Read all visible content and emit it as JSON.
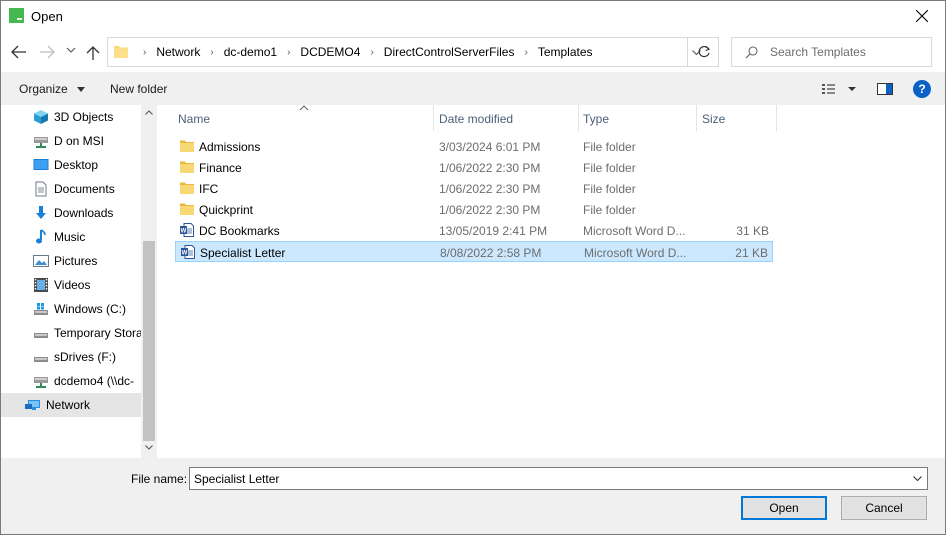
{
  "window": {
    "title": "Open"
  },
  "address": {
    "breadcrumbs": [
      "Network",
      "dc-demo1",
      "DCDEMO4",
      "DirectControlServerFiles",
      "Templates"
    ]
  },
  "search": {
    "placeholder": "Search Templates"
  },
  "toolbar": {
    "organize_label": "Organize",
    "new_folder_label": "New folder",
    "help_label": "?"
  },
  "sidebar": {
    "items": [
      {
        "label": "3D Objects",
        "icon": "cube-icon"
      },
      {
        "label": "D on MSI",
        "icon": "network-drive-icon"
      },
      {
        "label": "Desktop",
        "icon": "desktop-icon"
      },
      {
        "label": "Documents",
        "icon": "documents-icon"
      },
      {
        "label": "Downloads",
        "icon": "download-icon"
      },
      {
        "label": "Music",
        "icon": "music-icon"
      },
      {
        "label": "Pictures",
        "icon": "pictures-icon"
      },
      {
        "label": "Videos",
        "icon": "videos-icon"
      },
      {
        "label": "Windows (C:)",
        "icon": "windows-drive-icon"
      },
      {
        "label": "Temporary Stora",
        "icon": "drive-icon"
      },
      {
        "label": "sDrives (F:)",
        "icon": "drive-icon"
      },
      {
        "label": "dcdemo4 (\\\\dc-",
        "icon": "network-drive-icon"
      },
      {
        "label": "Network",
        "icon": "network-icon"
      }
    ]
  },
  "columns": {
    "name": "Name",
    "date": "Date modified",
    "type": "Type",
    "size": "Size"
  },
  "files": [
    {
      "name": "Admissions",
      "date": "3/03/2024 6:01 PM",
      "type": "File folder",
      "size": "",
      "icon": "folder-icon"
    },
    {
      "name": "Finance",
      "date": "1/06/2022 2:30 PM",
      "type": "File folder",
      "size": "",
      "icon": "folder-icon"
    },
    {
      "name": "IFC",
      "date": "1/06/2022 2:30 PM",
      "type": "File folder",
      "size": "",
      "icon": "folder-icon"
    },
    {
      "name": "Quickprint",
      "date": "1/06/2022 2:30 PM",
      "type": "File folder",
      "size": "",
      "icon": "folder-icon"
    },
    {
      "name": "DC Bookmarks",
      "date": "13/05/2019 2:41 PM",
      "type": "Microsoft Word D...",
      "size": "31 KB",
      "icon": "word-doc-icon"
    },
    {
      "name": "Specialist Letter",
      "date": "8/08/2022 2:58 PM",
      "type": "Microsoft Word D...",
      "size": "21 KB",
      "icon": "word-doc-icon"
    }
  ],
  "footer": {
    "file_name_label": "File name:",
    "file_name_value": "Specialist Letter",
    "open_label": "Open",
    "cancel_label": "Cancel"
  },
  "colors": {
    "selection_bg": "#cce8ff",
    "selection_border": "#99d1ff",
    "accent": "#0078d7",
    "folder": "#f8d775"
  }
}
